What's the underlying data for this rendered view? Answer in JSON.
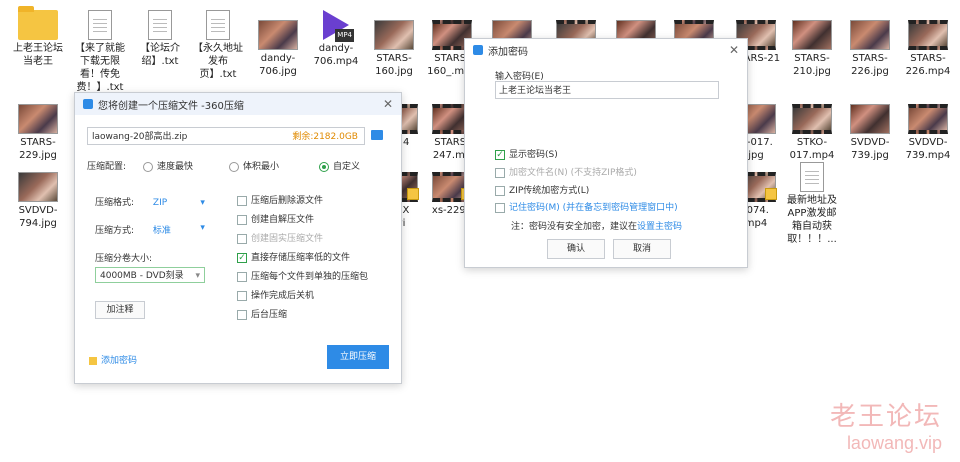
{
  "files": {
    "f1": "上老王论坛当老王",
    "f2": "【来了就能下载无限看！传免费！】.txt",
    "f3": "【论坛介绍】.txt",
    "f4": "【永久地址发布页】.txt",
    "f5": "dandy-706.jpg",
    "f6": "dandy-706.mp4",
    "f7": "STARS-160.jpg",
    "f8": "STARS-160_.mp4",
    "f9": "STARS-210.jpg",
    "f10": "STARS-226.jpg",
    "f11": "STARS-226.mp4",
    "f12": "STARS-229.jpg",
    "f13": "STARS-247.mp",
    "f14": "STKO-017.mp4",
    "f15": "SVDVD-739.jpg",
    "f16": "SVDVD-739.mp4",
    "f17": "SVDVD-794.jpg",
    "f18": "xs-2299",
    "f19": "最新地址及APP激发邮箱自动获取！！！...",
    "p1": "STARS-21",
    "p2": "S-24",
    "p3": "D-017.",
    "p4": "49.X",
    "p5": "avi",
    "p6": "-074.",
    "p7": "mp4",
    "p8": "jpg",
    "p9": "4"
  },
  "zip_dialog": {
    "title": "您将创建一个压缩文件 -360压缩",
    "filename": "laowang-20部高出.zip",
    "free_space": "剩余:2182.0GB",
    "profile_label": "压缩配置:",
    "profile_options": [
      "速度最快",
      "体积最小",
      "自定义"
    ],
    "format_label": "压缩格式:",
    "format_value": "ZIP",
    "method_label": "压缩方式:",
    "method_value": "标准",
    "split_label": "压缩分卷大小:",
    "split_value": "4000MB - DVD刻录",
    "comment_button": "加注释",
    "options": [
      "压缩后删除源文件",
      "创建自解压文件",
      "创建固实压缩文件",
      "直接存储压缩率低的文件",
      "压缩每个文件到单独的压缩包",
      "操作完成后关机",
      "后台压缩"
    ],
    "add_password": "添加密码",
    "start_button": "立即压缩"
  },
  "pwd_dialog": {
    "title": "添加密码",
    "input_label": "输入密码(E)",
    "password_value": "上老王论坛当老王",
    "options": [
      "显示密码(S)",
      "加密文件名(N) (不支持ZIP格式)",
      "ZIP传统加密方式(L)",
      "记住密码(M) (并在备忘到密码管理窗口中)"
    ],
    "note_prefix": "注：密码没有安全加密，建议在",
    "note_link": "设置主密码",
    "ok": "确认",
    "cancel": "取消"
  },
  "watermark": {
    "line1": "老王论坛",
    "line2": "laowang.vip"
  }
}
